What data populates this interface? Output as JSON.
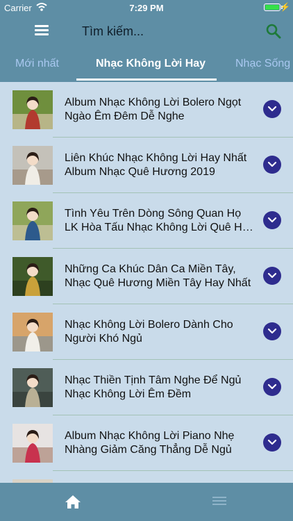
{
  "status_bar": {
    "carrier": "Carrier",
    "time": "7:29 PM",
    "battery_level": 1.0
  },
  "header": {
    "search_placeholder": "Tìm kiếm..."
  },
  "tabs": [
    {
      "label": "Mới nhất",
      "active": false
    },
    {
      "label": "Nhạc Không Lời Hay",
      "active": true
    },
    {
      "label": "Nhạc Sống Hay",
      "active": false
    }
  ],
  "songs": [
    {
      "title_line1": "Album Nhạc Không Lời Bolero Ngọt",
      "title_line2": "Ngào Êm Đêm Dễ Nghe",
      "thumb_colors": [
        "#6f8f3d",
        "#b23a2f",
        "#f2d6c4"
      ]
    },
    {
      "title_line1": "Liên Khúc Nhạc Không Lời Hay Nhất",
      "title_line2": "Album Nhạc Quê Hương 2019",
      "thumb_colors": [
        "#c4c1b9",
        "#f0ede6",
        "#8f7a66"
      ]
    },
    {
      "title_line1": "Tình Yêu Trên Dòng Sông Quan Họ",
      "title_line2": "LK Hòa Tấu Nhạc Không Lời Quê Hương",
      "thumb_colors": [
        "#8fa65a",
        "#2d5a8c",
        "#e4d2c2"
      ]
    },
    {
      "title_line1": "Những Ca Khúc Dân Ca Miền Tây,",
      "title_line2": "Nhạc Quê Hương Miền Tây Hay Nhất",
      "thumb_colors": [
        "#3f5a2a",
        "#c9a13a",
        "#1f2b16"
      ]
    },
    {
      "title_line1": "Nhạc Không Lời Bolero Dành Cho",
      "title_line2": "Người Khó Ngủ",
      "thumb_colors": [
        "#d7a46a",
        "#f1efe9",
        "#6c8da6"
      ]
    },
    {
      "title_line1": "Nhạc Thiền Tịnh Tâm Nghe Để Ngủ",
      "title_line2": "Nhạc Không Lời Êm Đềm",
      "thumb_colors": [
        "#4f5d57",
        "#b9b095",
        "#2a2f2c"
      ]
    },
    {
      "title_line1": "Album Nhạc Không Lời Piano Nhẹ",
      "title_line2": "Nhàng Giảm Căng Thẳng Dễ Ngủ",
      "thumb_colors": [
        "#e7e3e2",
        "#c8324e",
        "#9a6e5a"
      ]
    },
    {
      "title_line1": "",
      "title_line2": "",
      "thumb_colors": [
        "#d9d3c6",
        "#9c9388",
        "#ece8e0"
      ]
    }
  ],
  "bottom_bar": {
    "items": [
      {
        "icon": "home-icon",
        "active": true
      },
      {
        "icon": "list-icon",
        "active": false
      }
    ]
  },
  "colors": {
    "bar": "#5e8ea5",
    "list_bg": "#c9dbea",
    "tab_inactive": "#a9c8f0",
    "chevron_bg": "#2e2c8e",
    "separator": "#a3c2b6",
    "search_icon": "#1e7a3a"
  }
}
